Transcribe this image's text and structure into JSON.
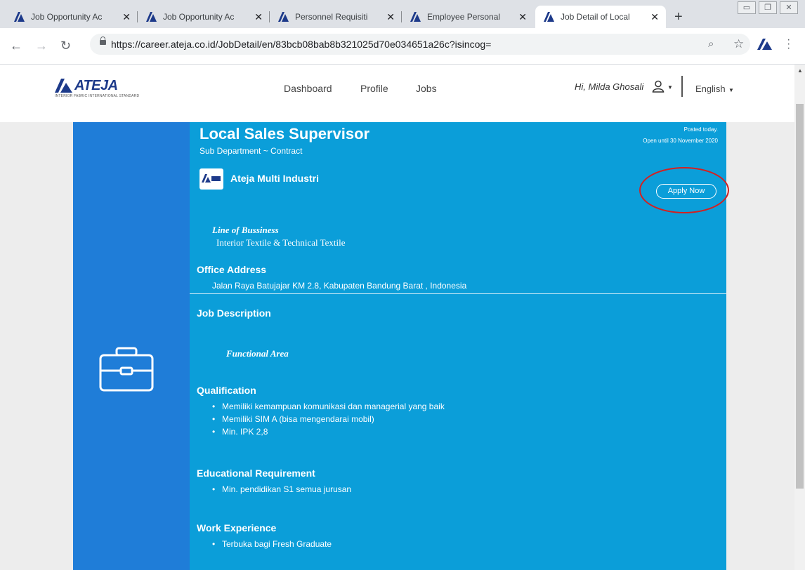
{
  "browser": {
    "tabs": [
      {
        "title": "Job Opportunity Ac",
        "close": "✕",
        "active": false
      },
      {
        "title": "Job Opportunity Ac",
        "close": "✕",
        "active": false
      },
      {
        "title": "Personnel Requisiti",
        "close": "✕",
        "active": false
      },
      {
        "title": "Employee Personal",
        "close": "✕",
        "active": false
      },
      {
        "title": "Job Detail of Local",
        "close": "✕",
        "active": true
      }
    ],
    "new_tab": "+",
    "url": "https://career.ateja.co.id/JobDetail/en/83bcb08bab8b321025d70e034651a26c?isincog=",
    "icons": {
      "back": "back-arrow-icon",
      "forward": "forward-arrow-icon",
      "reload": "reload-icon",
      "zoom": "zoom-icon",
      "bookmark": "star-icon",
      "menu": "kebab-menu-icon"
    }
  },
  "site": {
    "brand": "ATEJA",
    "brand_tagline": "INTERIOR FABRIC INTERNATIONAL STANDARD",
    "nav": [
      "Dashboard",
      "Profile",
      "Jobs"
    ],
    "greeting": "Hi, Milda Ghosali",
    "language": "English"
  },
  "job": {
    "title": "Local Sales Supervisor",
    "subtitle": "Sub Department ~ Contract",
    "posted": "Posted today.",
    "open_until": "Open until 30 November 2020",
    "company": "Ateja Multi Industri",
    "apply_label": "Apply Now",
    "line_of_business_label": "Line of Bussiness",
    "line_of_business": "Interior Textile & Technical Textile",
    "office_address_label": "Office Address",
    "office_address": "Jalan Raya Batujajar KM 2.8, Kabupaten Bandung Barat , Indonesia",
    "job_description_label": "Job Description",
    "functional_area_label": "Functional Area",
    "qualification_label": "Qualification",
    "qualifications": [
      "Memiliki kemampuan komunikasi dan managerial yang baik",
      "Memiliki SIM A (bisa mengendarai mobil)",
      "Min. IPK 2,8"
    ],
    "education_label": "Educational Requirement",
    "education": [
      "Min. pendidikan S1 semua jurusan"
    ],
    "experience_label": "Work Experience",
    "experience": [
      "Terbuka bagi Fresh Graduate"
    ]
  },
  "colors": {
    "brand_blue": "#1d3a8a",
    "side_panel": "#1f7dd8",
    "main_panel": "#0b9ed9",
    "highlight_ring": "#d42020"
  }
}
